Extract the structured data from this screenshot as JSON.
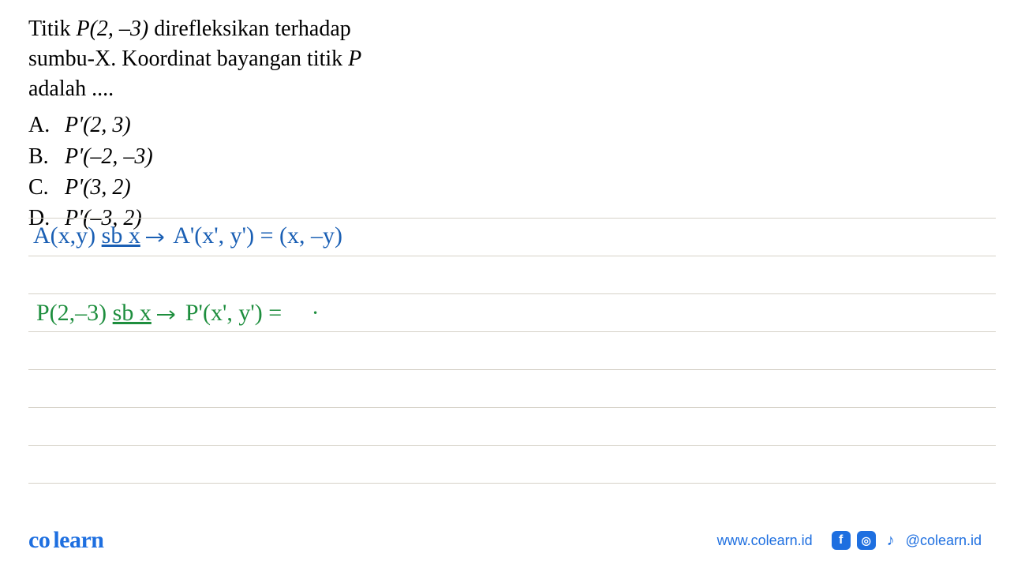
{
  "question": {
    "line1_pre": "Titik ",
    "line1_point": "P(2, –3)",
    "line1_post": " direfleksikan terhadap",
    "line2": "sumbu-X. Koordinat bayangan titik ",
    "line2_pointvar": "P",
    "line3": "adalah ...."
  },
  "options": {
    "a_letter": "A.",
    "a_value": "P'(2, 3)",
    "b_letter": "B.",
    "b_value": "P'(–2, –3)",
    "c_letter": "C.",
    "c_value": "P'(3, 2)",
    "d_letter": "D.",
    "d_value": "P'(–3, 2)"
  },
  "handwriting": {
    "rule_line1_left": "A(x,y)",
    "rule_line1_mid": "sb x",
    "rule_line1_right": "A'(x', y') = (x, –y)",
    "rule_line2_left": "P(2,–3)",
    "rule_line2_mid": "sb x",
    "rule_line2_right": "P'(x', y') =",
    "rule_line2_dot": "·"
  },
  "footer": {
    "logo_co": "co",
    "logo_learn": "learn",
    "url": "www.colearn.id",
    "handle": "@colearn.id",
    "fb_glyph": "f",
    "ig_glyph": "◎",
    "tt_glyph": "♪"
  },
  "colors": {
    "brand": "#1e6fe0",
    "hw_blue": "#1a5fb4",
    "hw_green": "#1e8e3e",
    "rule": "#d6d2c8"
  }
}
